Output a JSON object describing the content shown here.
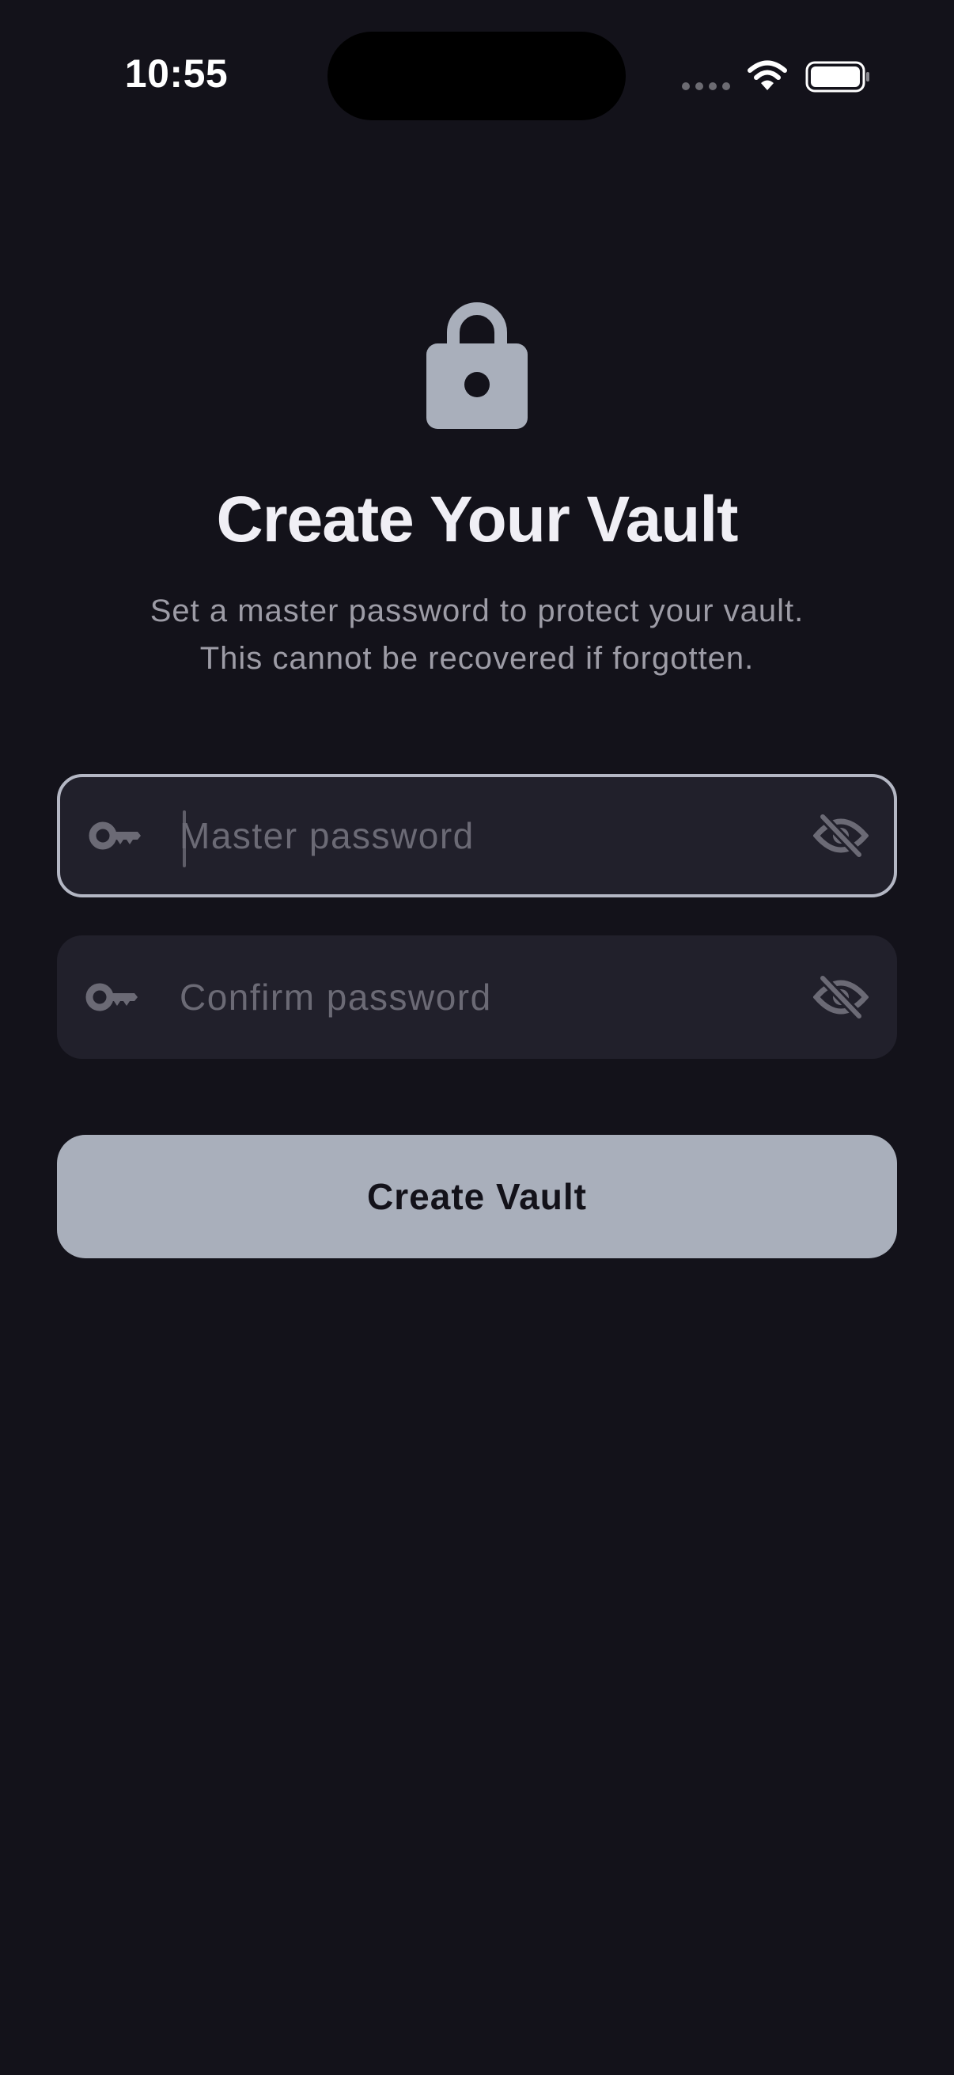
{
  "status_bar": {
    "time": "10:55"
  },
  "header": {
    "icon": "lock-icon",
    "title": "Create Your Vault",
    "subtitle_line1": "Set a master password to protect your vault.",
    "subtitle_line2": "This cannot be recovered if forgotten."
  },
  "form": {
    "master_password": {
      "placeholder": "Master password",
      "value": "",
      "focused": true,
      "leading_icon": "key-icon",
      "trailing_icon": "eye-slash-icon"
    },
    "confirm_password": {
      "placeholder": "Confirm password",
      "value": "",
      "focused": false,
      "leading_icon": "key-icon",
      "trailing_icon": "eye-slash-icon"
    },
    "submit_label": "Create Vault"
  },
  "colors": {
    "background": "#13121a",
    "field_background": "#21202b",
    "focus_border": "#b4b7c4",
    "button_background": "#a9afbb",
    "text_primary": "#f0eff5",
    "text_secondary": "#9d9ca6",
    "placeholder": "#6b6a75"
  }
}
